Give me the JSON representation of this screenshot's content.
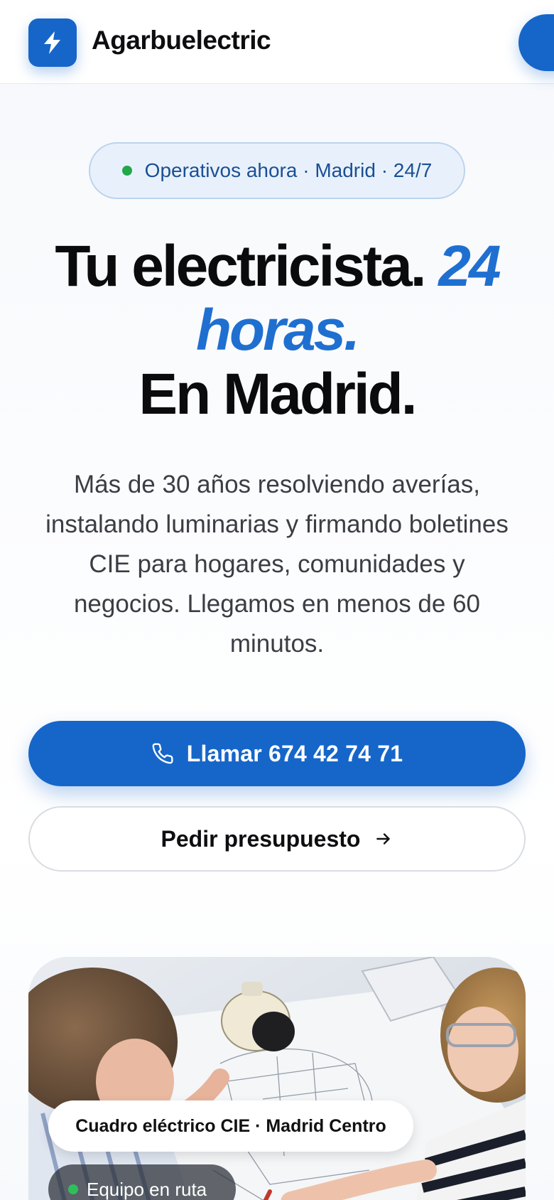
{
  "header": {
    "brand": "Agarbuelectric",
    "logo_icon": "bolt-icon",
    "accent_color": "#1666c9"
  },
  "hero": {
    "status": "Operativos ahora · Madrid · 24/7",
    "headline": {
      "part1": "Tu electricista.",
      "accent1": "24",
      "accent2": "horas.",
      "part2": "En Madrid."
    },
    "description": "Más de 30 años resolviendo averías, instalando luminarias y firmando boletines CIE para hogares, comunidades y negocios. Llegamos en menos de 60 minutos.",
    "call_label": "Llamar 674 42 74 71",
    "call_icon": "phone-icon",
    "quote_label": "Pedir presupuesto",
    "quote_icon": "arrow-right-icon"
  },
  "photo": {
    "caption": "Cuadro eléctrico CIE · Madrid Centro",
    "badge": "Equipo en ruta"
  }
}
